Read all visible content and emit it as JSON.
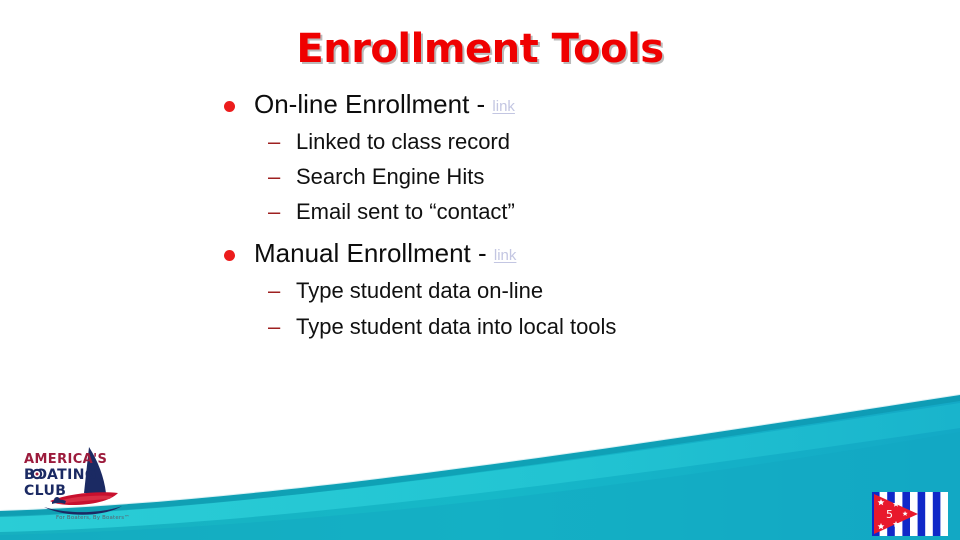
{
  "slide": {
    "title": "Enrollment Tools",
    "page_number": "5",
    "colors": {
      "title_red": "#ef0000",
      "bullet_red": "#ec1c1c",
      "dash_red": "#9e2020",
      "link_gray": "#c3c6e2",
      "wave_teal": "#19b5c4",
      "wave_teal_dark": "#0fa7bb",
      "wave_cyan": "#23c9d4",
      "logo_navy": "#1b2a63",
      "logo_red": "#c8102e",
      "logo_maroon": "#9c1b3c",
      "ensign_blue": "#1028c8",
      "ensign_red": "#e8192c"
    }
  },
  "content": {
    "items": [
      {
        "level": 1,
        "text": "On-line Enrollment",
        "separator": " - ",
        "link_label": "link"
      },
      {
        "level": 2,
        "marker": "–",
        "text": "Linked to class record"
      },
      {
        "level": 2,
        "marker": "–",
        "text": "Search Engine Hits"
      },
      {
        "level": 2,
        "marker": "–",
        "text": "Email sent to “contact”"
      },
      {
        "level": 1,
        "text": "Manual Enrollment",
        "separator": " - ",
        "link_label": "link"
      },
      {
        "level": 2,
        "marker": "–",
        "text": "Type student data on-line"
      },
      {
        "level": 2,
        "marker": "–",
        "text": "Type student data into local tools"
      }
    ]
  },
  "logo": {
    "line1": "AMERICA'S",
    "line2": "BOATING",
    "line3": "CLUB",
    "trademark": "™",
    "tagline": "For Boaters, By Boaters™"
  },
  "ensign": {
    "number": "5"
  }
}
